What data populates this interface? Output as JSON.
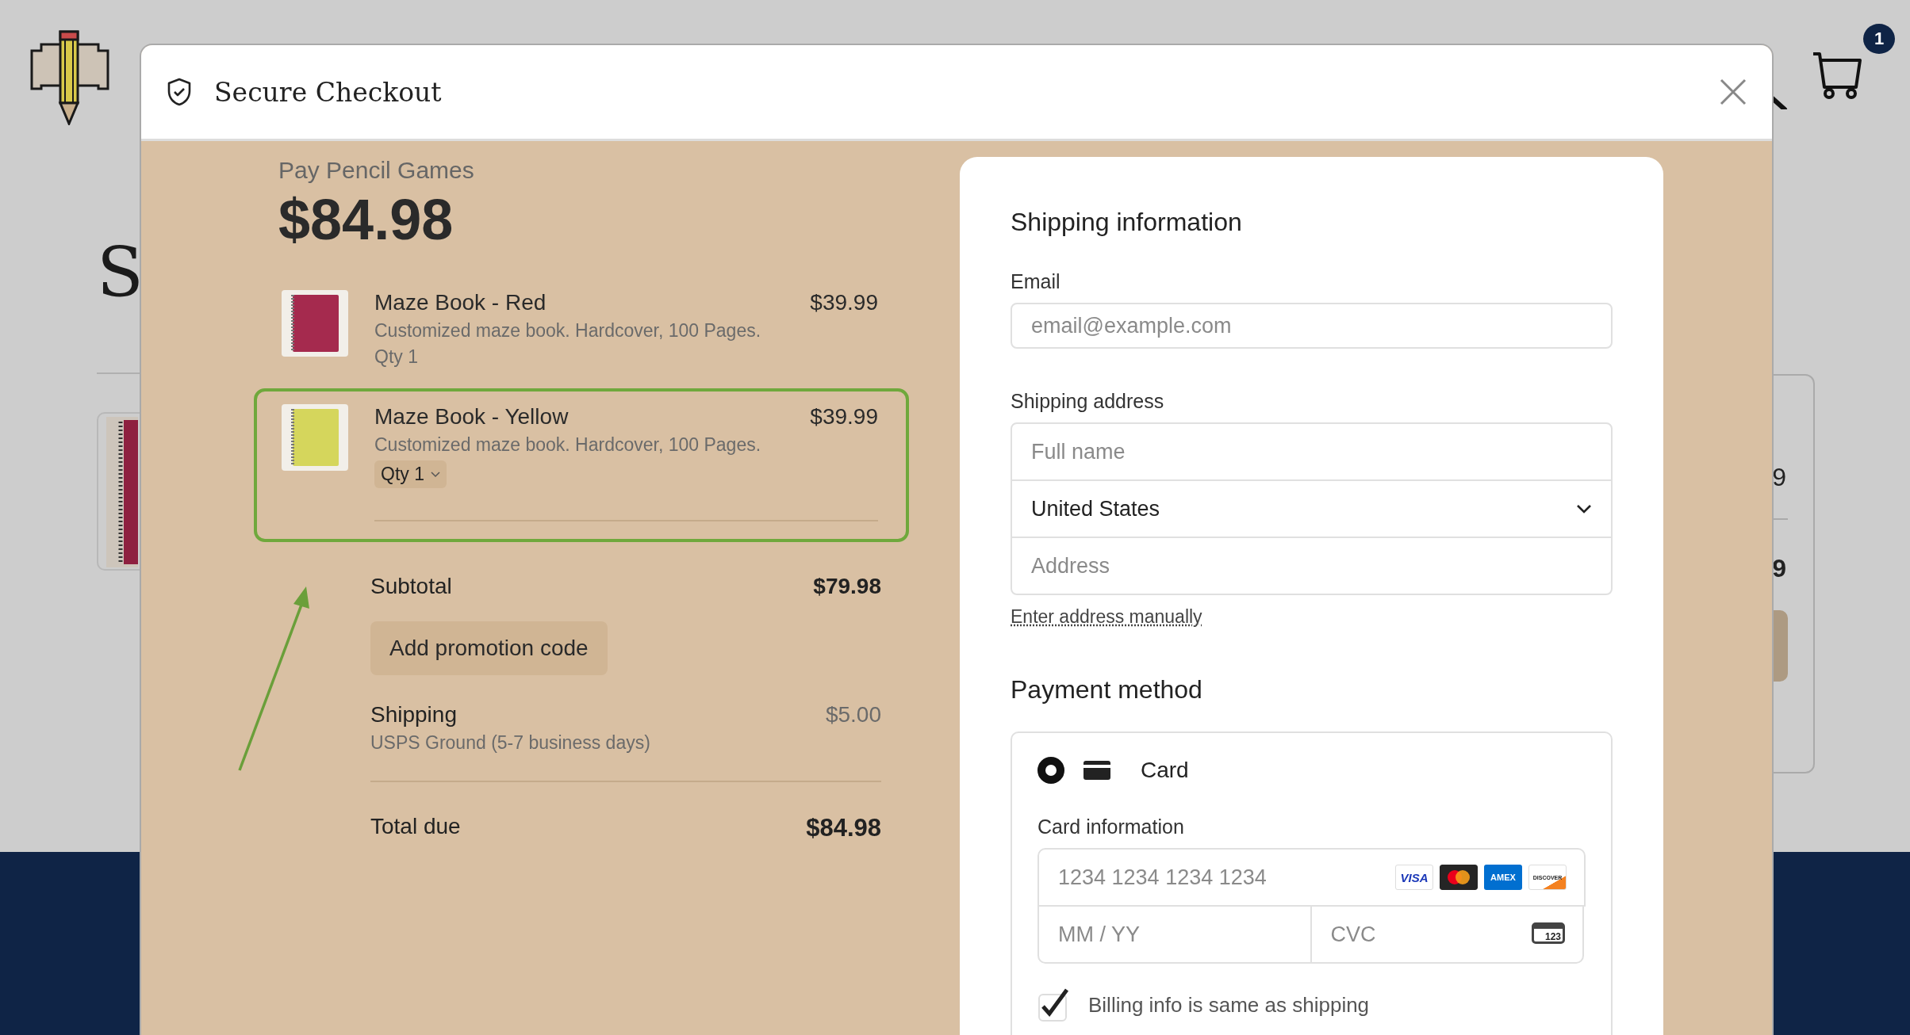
{
  "site_header": {
    "cart_count": "1"
  },
  "background": {
    "heading_fragment": "S",
    "price_fragments": [
      "9",
      "9"
    ]
  },
  "checkout": {
    "title": "Secure Checkout",
    "merchant": "Pay Pencil Games",
    "amount": "$84.98",
    "items": [
      {
        "name": "Maze Book - Red",
        "price": "$39.99",
        "description": "Customized maze book. Hardcover, 100 Pages.",
        "qty": "Qty 1",
        "qty_dropdown": false,
        "highlighted": false,
        "color": "#a52a4e"
      },
      {
        "name": "Maze Book - Yellow",
        "price": "$39.99",
        "description": "Customized maze book. Hardcover, 100 Pages.",
        "qty": "Qty 1",
        "qty_dropdown": true,
        "highlighted": true,
        "color": "#d5d65c"
      }
    ],
    "subtotal": {
      "label": "Subtotal",
      "value": "$79.98"
    },
    "promo_button": "Add promotion code",
    "shipping": {
      "label": "Shipping",
      "detail": "USPS Ground (5-7 business days)",
      "value": "$5.00"
    },
    "total": {
      "label": "Total due",
      "value": "$84.98"
    }
  },
  "shipping_form": {
    "title": "Shipping information",
    "email_label": "Email",
    "email_placeholder": "email@example.com",
    "address_label": "Shipping address",
    "name_placeholder": "Full name",
    "country": "United States",
    "address_placeholder": "Address",
    "manual_link": "Enter address manually"
  },
  "payment": {
    "title": "Payment method",
    "methods": [
      {
        "label": "Card",
        "selected": true
      }
    ],
    "card_label": "Card information",
    "card_number_placeholder": "1234 1234 1234 1234",
    "brands": [
      {
        "kind": "visa",
        "label": "VISA"
      },
      {
        "kind": "mastercard"
      },
      {
        "kind": "amex",
        "label": "AMEX"
      },
      {
        "kind": "discover",
        "label": "DISCOVER"
      }
    ],
    "expiry_placeholder": "MM / YY",
    "cvc_placeholder": "CVC",
    "cvc_icon_text": "123",
    "billing_same": {
      "label": "Billing info is same as shipping",
      "checked": true
    }
  }
}
